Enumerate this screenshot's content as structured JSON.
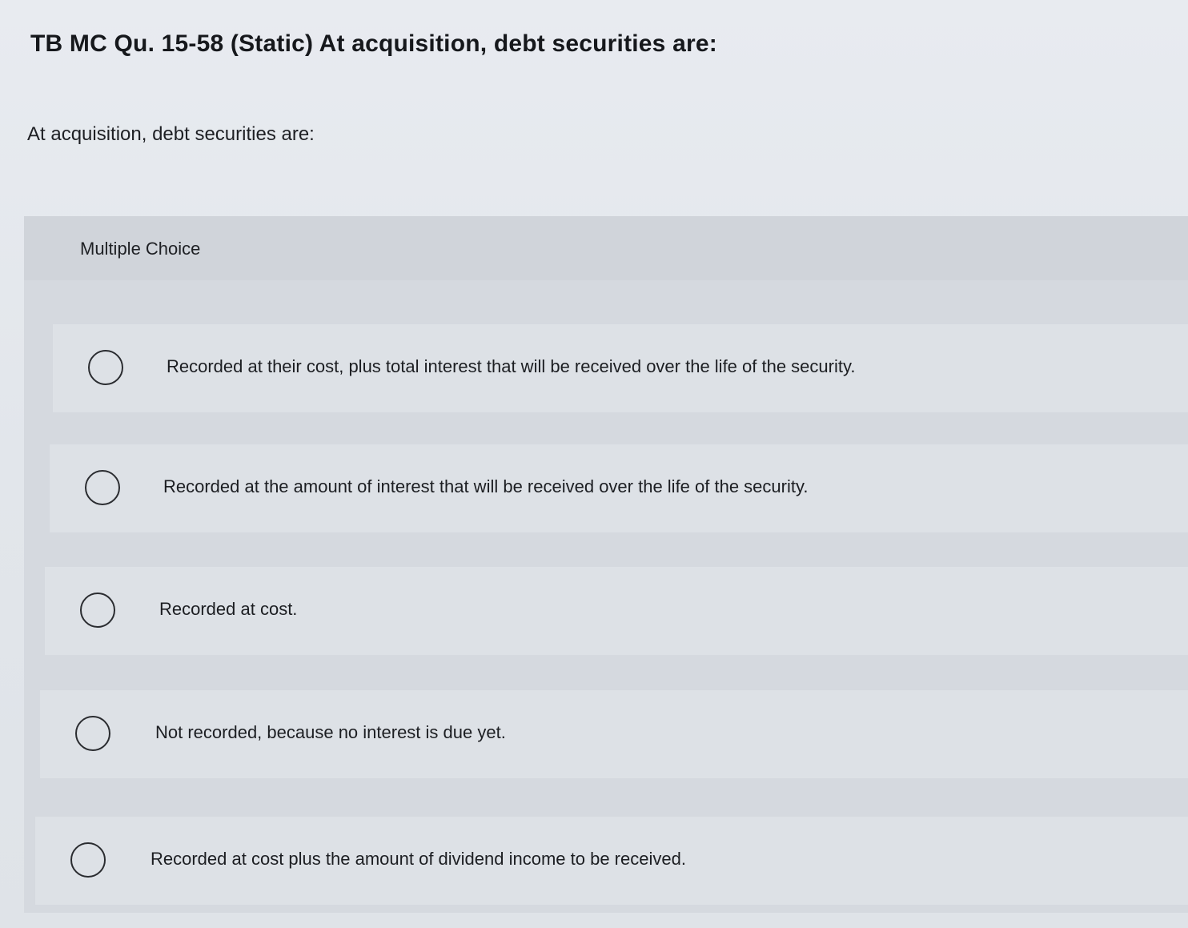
{
  "question": {
    "title": "TB MC Qu. 15-58 (Static) At acquisition, debt securities are:",
    "prompt": "At acquisition, debt securities are:"
  },
  "multiple_choice": {
    "label": "Multiple Choice",
    "options": [
      {
        "text": "Recorded at their cost, plus total interest that will be received over the life of the security.",
        "selected": false
      },
      {
        "text": "Recorded at the amount of interest that will be received over the life of the security.",
        "selected": false
      },
      {
        "text": "Recorded at cost.",
        "selected": false
      },
      {
        "text": "Not recorded, because no interest is due yet.",
        "selected": false
      },
      {
        "text": "Recorded at cost plus the amount of dividend income to be received.",
        "selected": false
      }
    ]
  }
}
